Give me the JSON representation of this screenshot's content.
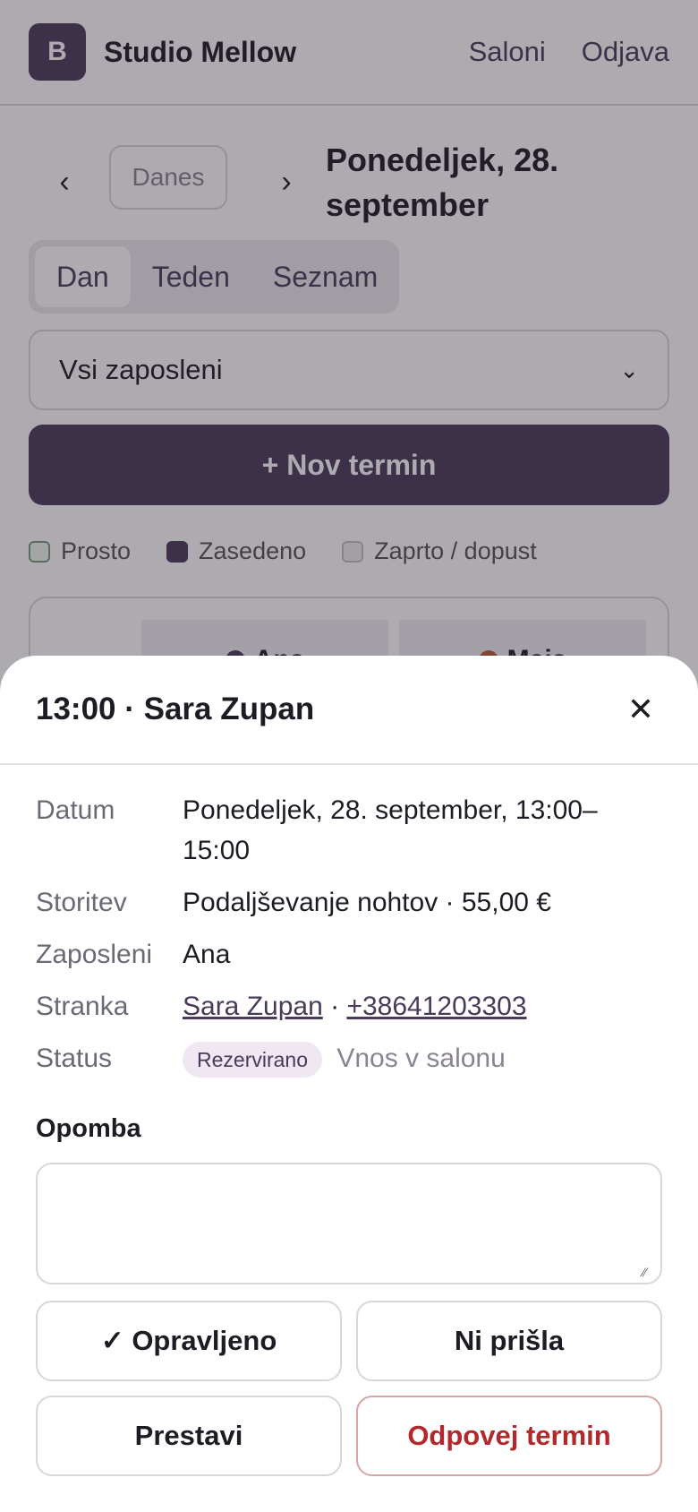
{
  "app": {
    "logo_letter": "B",
    "brand": "Studio Mellow",
    "nav": [
      "Saloni",
      "Odjava"
    ]
  },
  "calendar": {
    "today_label": "Danes",
    "date_title": "Ponedeljek, 28. september",
    "view_tabs": [
      "Dan",
      "Teden",
      "Seznam"
    ],
    "active_view": "Dan",
    "staff_filter": "Vsi zaposleni",
    "new_button": "+ Nov termin",
    "legend": [
      "Prosto",
      "Zasedeno",
      "Zaprto / dopust"
    ],
    "staff_columns": [
      {
        "name": "Ana",
        "color": "#4a3a5a"
      },
      {
        "name": "Maja",
        "color": "#b5603a"
      }
    ]
  },
  "sheet": {
    "title": "13:00 · Sara Zupan",
    "details": {
      "date_label": "Datum",
      "date_value": "Ponedeljek, 28. september, 13:00–15:00",
      "service_label": "Storitev",
      "service_value": "Podaljševanje nohtov · 55,00 €",
      "staff_label": "Zaposleni",
      "staff_value": "Ana",
      "client_label": "Stranka",
      "client_name": "Sara Zupan",
      "client_separator": " · ",
      "client_phone": "+38641203303",
      "status_label": "Status",
      "status_badge": "Rezervirano",
      "status_source": "Vnos v salonu"
    },
    "note_label": "Opomba",
    "note_value": "",
    "actions": {
      "done": "✓ Opravljeno",
      "no_show": "Ni prišla",
      "reschedule": "Prestavi",
      "cancel": "Odpovej termin"
    }
  },
  "colors": {
    "primary": "#4a3a5a",
    "danger": "#b3292b",
    "badge_bg": "#efe7f2"
  }
}
